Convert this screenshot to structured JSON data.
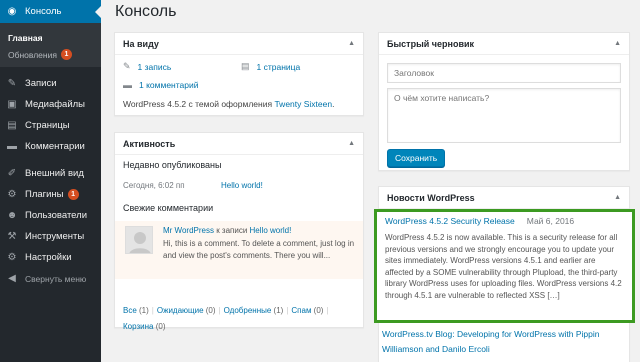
{
  "sidebar": {
    "items": [
      {
        "label": "Консоль",
        "icon": "dashboard-icon",
        "glyph": "◉",
        "active": true
      },
      {
        "label": "Записи",
        "icon": "pin-icon",
        "glyph": "✎"
      },
      {
        "label": "Медиафайлы",
        "icon": "media-icon",
        "glyph": "▣"
      },
      {
        "label": "Страницы",
        "icon": "pages-icon",
        "glyph": "▤"
      },
      {
        "label": "Комментарии",
        "icon": "comments-icon",
        "glyph": "▬"
      },
      {
        "label": "Внешний вид",
        "icon": "appearance-icon",
        "glyph": "✐"
      },
      {
        "label": "Плагины",
        "icon": "plugins-icon",
        "glyph": "⚙",
        "badge": "1"
      },
      {
        "label": "Пользователи",
        "icon": "users-icon",
        "glyph": "☻"
      },
      {
        "label": "Инструменты",
        "icon": "tools-icon",
        "glyph": "⚒"
      },
      {
        "label": "Настройки",
        "icon": "settings-icon",
        "glyph": "⚙"
      }
    ],
    "submenu": {
      "home": "Главная",
      "updates": "Обновления",
      "updates_badge": "1"
    },
    "collapse": "Свернуть меню",
    "active_color": "#0073aa",
    "bg_color": "#23282d"
  },
  "page": {
    "title": "Консоль"
  },
  "glance": {
    "title": "На виду",
    "posts": "1 запись",
    "pages": "1 страница",
    "comments": "1 комментарий",
    "version_prefix": "WordPress 4.5.2 с темой оформления ",
    "theme": "Twenty Sixteen",
    "version_suffix": "."
  },
  "activity": {
    "title": "Активность",
    "recently_published": "Недавно опубликованы",
    "pub_date": "Сегодня, 6:02 пп",
    "pub_link": "Hello world!",
    "recent_comments": "Свежие комментарии",
    "comment_author": "Mr WordPress",
    "comment_on": " к записи ",
    "comment_post": "Hello world!",
    "comment_text": "Hi, this is a comment. To delete a comment, just log in and view the post's comments. There you will...",
    "filters": {
      "all": "Все",
      "all_count": " (1)",
      "pending": "Ожидающие",
      "pending_count": " (0)",
      "approved": "Одобренные",
      "approved_count": " (1)",
      "spam": "Спам",
      "spam_count": " (0)",
      "trash": "Корзина",
      "trash_count": " (0)"
    }
  },
  "quick_draft": {
    "title": "Быстрый черновик",
    "title_placeholder": "Заголовок",
    "content_placeholder": "О чём хотите написать?",
    "save_button": "Сохранить"
  },
  "news": {
    "title": "Новости WordPress",
    "item1_title": "WordPress 4.5.2 Security Release",
    "item1_date": "Май 6, 2016",
    "item1_body": "WordPress 4.5.2 is now available. This is a security release for all previous versions and we strongly encourage you to update your sites immediately. WordPress versions 4.5.1 and earlier are affected by a SOME vulnerability through Plupload, the third-party library WordPress uses for uploading files. WordPress versions 4.2 through 4.5.1 are vulnerable to reflected XSS […]",
    "item2_title": "WordPress.tv Blog: Developing for WordPress with Pippin Williamson and Danilo Ercoli",
    "highlight_color": "#3c9a21"
  }
}
